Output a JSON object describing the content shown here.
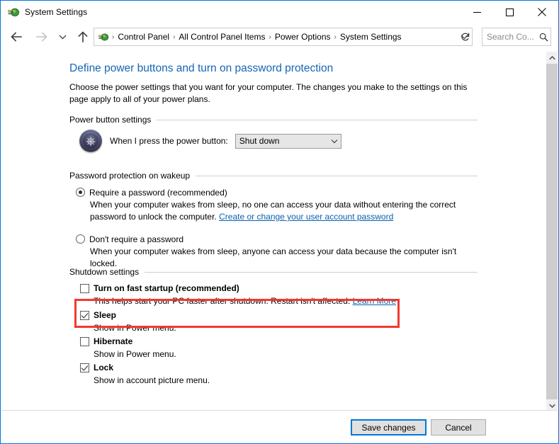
{
  "window": {
    "title": "System Settings",
    "icon": "power-options-icon",
    "caption": {
      "minimize": "minimize-icon",
      "maximize": "maximize-icon",
      "close": "close-icon"
    }
  },
  "navbar": {
    "back": "back-arrow-icon",
    "forward": "forward-arrow-icon",
    "recent": "recent-pages-chevron-icon",
    "up": "up-arrow-icon",
    "address_icon": "power-options-icon",
    "breadcrumbs": [
      "Control Panel",
      "All Control Panel Items",
      "Power Options",
      "System Settings"
    ],
    "separator": "›",
    "dropdown": "chevron-down-icon",
    "refresh": "↻",
    "search": {
      "placeholder": "Search Co...",
      "icon": "search-icon"
    }
  },
  "content": {
    "heading": "Define power buttons and turn on password protection",
    "subtext": "Choose the power settings that you want for your computer. The changes you make to the settings on this page apply to all of your power plans.",
    "power_group": {
      "title": "Power button settings",
      "icon": "power-button-icon",
      "label": "When I press the power button:",
      "select_value": "Shut down",
      "select_caret": "chevron-down-icon"
    },
    "password_group": {
      "title": "Password protection on wakeup",
      "options": [
        {
          "label": "Require a password (recommended)",
          "checked": true,
          "desc_before": "When your computer wakes from sleep, no one can access your data without entering the correct password to unlock the computer. ",
          "link": "Create or change your user account password",
          "desc_after": ""
        },
        {
          "label": "Don't require a password",
          "checked": false,
          "desc_before": "When your computer wakes from sleep, anyone can access your data because the computer isn't locked.",
          "link": "",
          "desc_after": ""
        }
      ]
    },
    "shutdown_group": {
      "title": "Shutdown settings",
      "items": [
        {
          "label": "Turn on fast startup (recommended)",
          "checked": false,
          "desc_before": "This helps start your PC faster after shutdown. Restart isn't affected. ",
          "link": "Learn More",
          "highlighted": true
        },
        {
          "label": "Sleep",
          "checked": true,
          "desc_before": "Show in Power menu.",
          "link": "",
          "highlighted": false
        },
        {
          "label": "Hibernate",
          "checked": false,
          "desc_before": "Show in Power menu.",
          "link": "",
          "highlighted": false
        },
        {
          "label": "Lock",
          "checked": true,
          "desc_before": "Show in account picture menu.",
          "link": "",
          "highlighted": false
        }
      ]
    }
  },
  "footer": {
    "save_label": "Save changes",
    "cancel_label": "Cancel"
  },
  "scrollbar": {
    "up": "scroll-up-arrow-icon",
    "down": "scroll-down-arrow-icon"
  },
  "colors": {
    "window_border": "#0078d7",
    "heading": "#1666b5",
    "link": "#0b5fb0",
    "highlight": "#f23a2e",
    "default_button_border": "#0078d7"
  }
}
